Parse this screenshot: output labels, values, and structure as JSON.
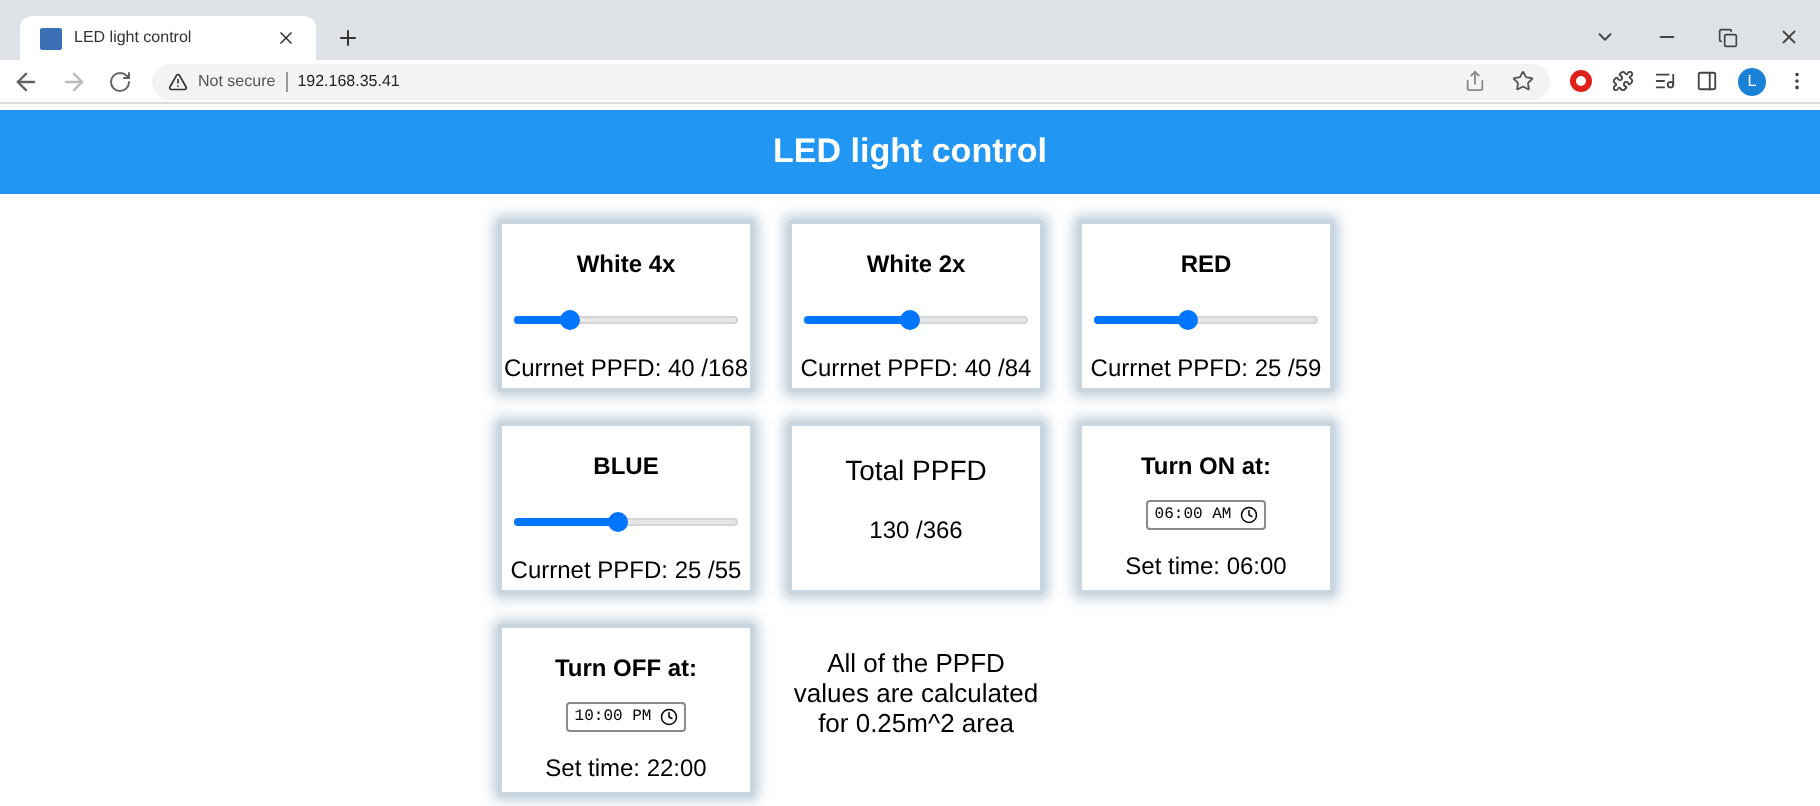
{
  "browser": {
    "tab_title": "LED light control",
    "security": "Not secure",
    "url": "192.168.35.41",
    "profile_initial": "L"
  },
  "header": {
    "title": "LED light control"
  },
  "cards": [
    {
      "kind": "slider",
      "title": "White 4x",
      "level": 0.25,
      "reading": "Currnet PPFD: 40 /168"
    },
    {
      "kind": "slider",
      "title": "White 2x",
      "level": 0.47,
      "reading": "Currnet PPFD: 40 /84"
    },
    {
      "kind": "slider",
      "title": "RED",
      "level": 0.42,
      "reading": "Currnet PPFD: 25 /59"
    },
    {
      "kind": "slider",
      "title": "BLUE",
      "level": 0.46,
      "reading": "Currnet PPFD: 25 /55"
    },
    {
      "kind": "total",
      "title": "Total PPFD",
      "reading": "130 /366"
    },
    {
      "kind": "timer",
      "title": "Turn ON at:",
      "value": "06:00 AM",
      "reading": "Set time: 06:00"
    },
    {
      "kind": "timer",
      "title": "Turn OFF at:",
      "value": "10:00 PM",
      "reading": "Set time: 22:00"
    },
    {
      "kind": "note",
      "text": "All of the PPFD values are calculated for 0.25m^2 area"
    }
  ]
}
